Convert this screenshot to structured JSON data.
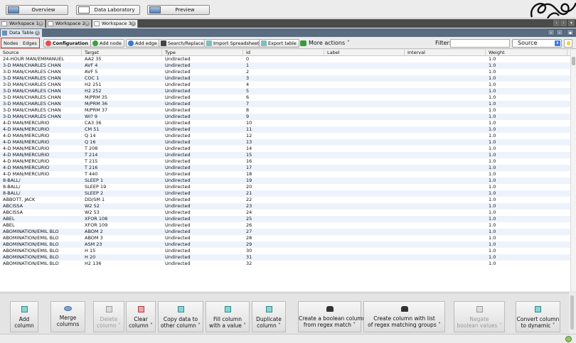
{
  "modes": [
    "Overview",
    "Data Laboratory",
    "Preview"
  ],
  "workspaces": [
    "Workspace 1",
    "Workspace 2",
    "Workspace 3"
  ],
  "data_table_tab": "Data Table",
  "toolbar": {
    "nodes": "Nodes",
    "edges": "Edges",
    "configuration": "Configuration",
    "add_node": "Add node",
    "add_edge": "Add edge",
    "search_replace": "Search/Replace",
    "import_spreadsheet": "Import Spreadsheet",
    "export_table": "Export table",
    "more_actions": "More actions",
    "filter_label": "Filter:",
    "column_select": "Source"
  },
  "columns": [
    "Source",
    "Target",
    "Type",
    "Id",
    "Label",
    "Interval",
    "Weight"
  ],
  "rows": [
    [
      "24-HOUR MAN/EMMANUEL",
      "AA2 35",
      "Undirected",
      "0",
      "",
      "",
      "1.0"
    ],
    [
      "3-D MAN/CHARLES CHAN",
      "AVF 4",
      "Undirected",
      "1",
      "",
      "",
      "1.0"
    ],
    [
      "3-D MAN/CHARLES CHAN",
      "AVF 5",
      "Undirected",
      "2",
      "",
      "",
      "1.0"
    ],
    [
      "3-D MAN/CHARLES CHAN",
      "COC 1",
      "Undirected",
      "3",
      "",
      "",
      "1.0"
    ],
    [
      "3-D MAN/CHARLES CHAN",
      "H2 251",
      "Undirected",
      "4",
      "",
      "",
      "1.0"
    ],
    [
      "3-D MAN/CHARLES CHAN",
      "H2 252",
      "Undirected",
      "5",
      "",
      "",
      "1.0"
    ],
    [
      "3-D MAN/CHARLES CHAN",
      "M/PRM 35",
      "Undirected",
      "6",
      "",
      "",
      "1.0"
    ],
    [
      "3-D MAN/CHARLES CHAN",
      "M/PRM 36",
      "Undirected",
      "7",
      "",
      "",
      "1.0"
    ],
    [
      "3-D MAN/CHARLES CHAN",
      "M/PRM 37",
      "Undirected",
      "8",
      "",
      "",
      "1.0"
    ],
    [
      "3-D MAN/CHARLES CHAN",
      "WI? 9",
      "Undirected",
      "9",
      "",
      "",
      "1.0"
    ],
    [
      "4-D MAN/MERCURIO",
      "CA3 36",
      "Undirected",
      "10",
      "",
      "",
      "1.0"
    ],
    [
      "4-D MAN/MERCURIO",
      "CM 51",
      "Undirected",
      "11",
      "",
      "",
      "1.0"
    ],
    [
      "4-D MAN/MERCURIO",
      "Q 14",
      "Undirected",
      "12",
      "",
      "",
      "1.0"
    ],
    [
      "4-D MAN/MERCURIO",
      "Q 16",
      "Undirected",
      "13",
      "",
      "",
      "1.0"
    ],
    [
      "4-D MAN/MERCURIO",
      "T 208",
      "Undirected",
      "14",
      "",
      "",
      "1.0"
    ],
    [
      "4-D MAN/MERCURIO",
      "T 214",
      "Undirected",
      "15",
      "",
      "",
      "1.0"
    ],
    [
      "4-D MAN/MERCURIO",
      "T 215",
      "Undirected",
      "16",
      "",
      "",
      "1.0"
    ],
    [
      "4-D MAN/MERCURIO",
      "T 216",
      "Undirected",
      "17",
      "",
      "",
      "1.0"
    ],
    [
      "4-D MAN/MERCURIO",
      "T 440",
      "Undirected",
      "18",
      "",
      "",
      "1.0"
    ],
    [
      "8-BALL/",
      "SLEEP 1",
      "Undirected",
      "19",
      "",
      "",
      "1.0"
    ],
    [
      "8-BALL/",
      "SLEEP 19",
      "Undirected",
      "20",
      "",
      "",
      "1.0"
    ],
    [
      "8-BALL/",
      "SLEEP 2",
      "Undirected",
      "21",
      "",
      "",
      "1.0"
    ],
    [
      "ABBOTT, JACK",
      "DD/SM 1",
      "Undirected",
      "22",
      "",
      "",
      "1.0"
    ],
    [
      "ABCISSA",
      "W2 52",
      "Undirected",
      "23",
      "",
      "",
      "1.0"
    ],
    [
      "ABCISSA",
      "W2 53",
      "Undirected",
      "24",
      "",
      "",
      "1.0"
    ],
    [
      "ABEL",
      "XFOR 108",
      "Undirected",
      "25",
      "",
      "",
      "1.0"
    ],
    [
      "ABEL",
      "XFOR 109",
      "Undirected",
      "26",
      "",
      "",
      "1.0"
    ],
    [
      "ABOMINATION/EMIL BLO",
      "ABOM 2",
      "Undirected",
      "27",
      "",
      "",
      "1.0"
    ],
    [
      "ABOMINATION/EMIL BLO",
      "ABOM 3",
      "Undirected",
      "28",
      "",
      "",
      "1.0"
    ],
    [
      "ABOMINATION/EMIL BLO",
      "ASM 23",
      "Undirected",
      "29",
      "",
      "",
      "1.0"
    ],
    [
      "ABOMINATION/EMIL BLO",
      "H 15",
      "Undirected",
      "30",
      "",
      "",
      "1.0"
    ],
    [
      "ABOMINATION/EMIL BLO",
      "H 20",
      "Undirected",
      "31",
      "",
      "",
      "1.0"
    ],
    [
      "ABOMINATION/EMIL BLO",
      "H2 136",
      "Undirected",
      "32",
      "",
      "",
      "1.0"
    ]
  ],
  "actions": [
    {
      "line1": "Add",
      "line2": "column",
      "icon": "table-icon",
      "enabled": true
    },
    {
      "line1": "Merge",
      "line2": "columns",
      "icon": "oval-icon",
      "enabled": true
    },
    {
      "line1": "Delete",
      "line2": "column ˅",
      "icon": "delete-column-icon",
      "enabled": false
    },
    {
      "line1": "Clear",
      "line2": "column ˅",
      "icon": "clear-column-icon",
      "enabled": true
    },
    {
      "line1": "Copy data to",
      "line2": "other column ˅",
      "icon": "copy-icon",
      "enabled": true
    },
    {
      "line1": "Fill column",
      "line2": "with a value ˅",
      "icon": "fill-icon",
      "enabled": true
    },
    {
      "line1": "Duplicate",
      "line2": "column ˅",
      "icon": "duplicate-icon",
      "enabled": true
    },
    {
      "line1": "Create a boolean column",
      "line2": "from regex match ˅",
      "icon": "binoculars-icon",
      "enabled": true
    },
    {
      "line1": "Create column with list",
      "line2": "of regex matching groups ˅",
      "icon": "binoculars-icon",
      "enabled": true
    },
    {
      "line1": "Negate",
      "line2": "boolean values ˅",
      "icon": "negate-icon",
      "enabled": false
    },
    {
      "line1": "Convert column",
      "line2": "to dynamic ˅",
      "icon": "convert-icon",
      "enabled": true
    }
  ],
  "ws_close_glyph": "×",
  "dropdown_arrow": "˅",
  "select_arrow": "⬍"
}
